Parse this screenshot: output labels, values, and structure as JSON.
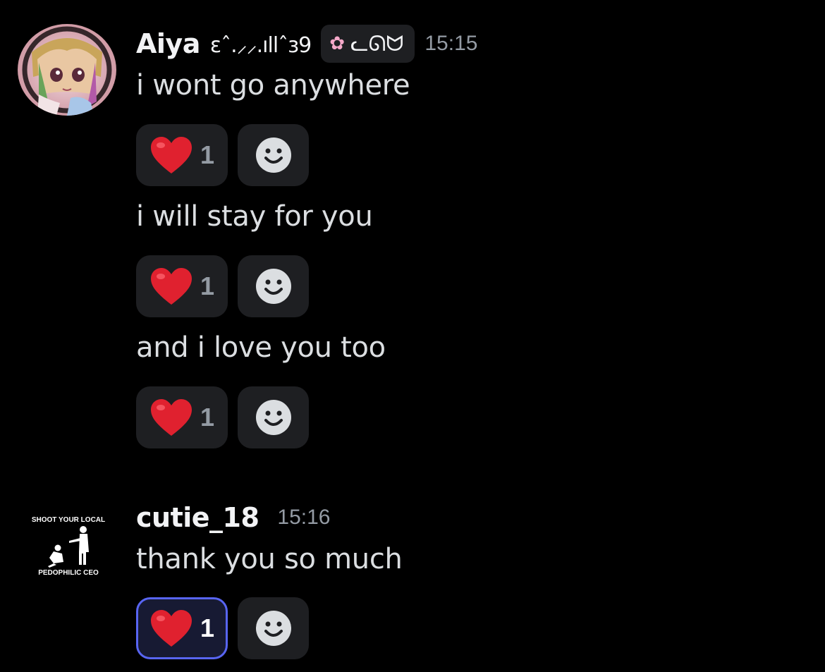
{
  "messages": [
    {
      "author": "Aiya",
      "name_deco": "ɛˆ.⸝⸝.ıllˆɜ9",
      "server_tag": "ᓚᘏᗢ",
      "tag_icon": "cherry-blossom-icon",
      "timestamp": "15:15",
      "avatar": "anime-girl-avatar",
      "lines": [
        {
          "text": "i wont go anywhere",
          "reaction": {
            "emoji": "heart-icon",
            "count": "1",
            "active": false
          }
        },
        {
          "text": "i will stay for you",
          "reaction": {
            "emoji": "heart-icon",
            "count": "1",
            "active": false
          }
        },
        {
          "text": "and i love you too",
          "reaction": {
            "emoji": "heart-icon",
            "count": "1",
            "active": false
          }
        }
      ]
    },
    {
      "author": "cutie_18",
      "timestamp": "15:16",
      "avatar": "meme-poster-avatar",
      "avatar_text_top": "SHOOT YOUR LOCAL",
      "avatar_text_bottom": "PEDOPHILIC CEO",
      "lines": [
        {
          "text": "thank you so much",
          "reaction": {
            "emoji": "heart-icon",
            "count": "1",
            "active": true
          }
        }
      ]
    }
  ],
  "colors": {
    "background": "#000000",
    "pill": "#1e1f22",
    "active_border": "#5865f2",
    "muted": "#949ba4",
    "heart": "#e0212f"
  }
}
